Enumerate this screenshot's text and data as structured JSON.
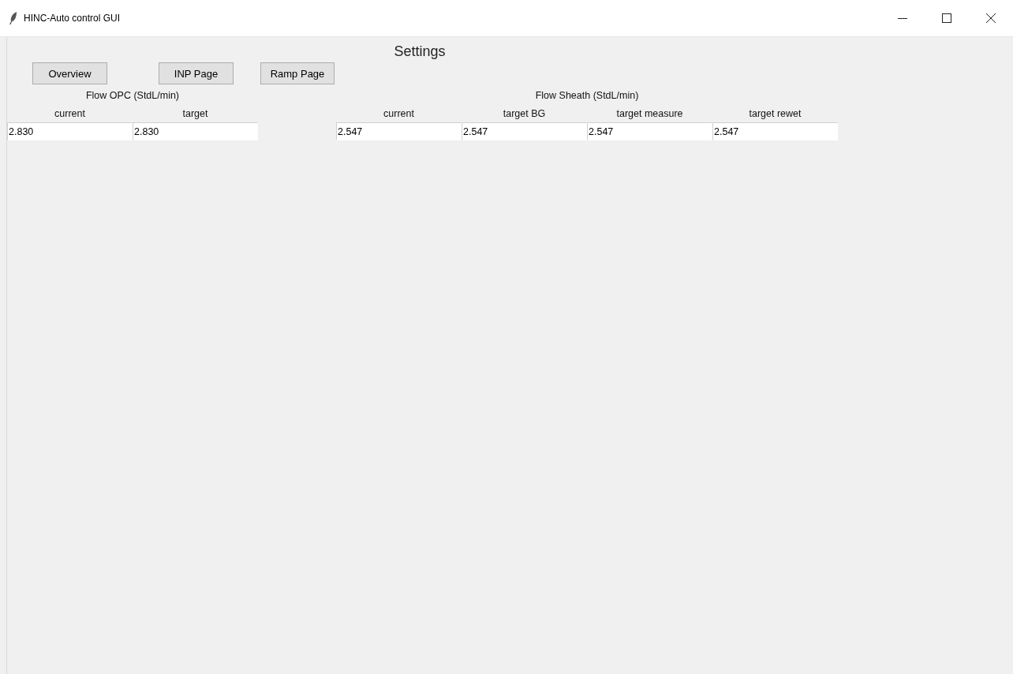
{
  "window": {
    "title": "HINC-Auto control GUI"
  },
  "heading": "Settings",
  "buttons": [
    "Overview",
    "INP Page",
    "Ramp Page"
  ],
  "groups": [
    {
      "title": "Flow OPC (StdL/min)",
      "fields": [
        {
          "label": "current",
          "value": "2.830"
        },
        {
          "label": "target",
          "value": "2.830"
        }
      ]
    },
    {
      "title": "Flow Sheath (StdL/min)",
      "fields": [
        {
          "label": "current",
          "value": "2.547"
        },
        {
          "label": "target BG",
          "value": "2.547"
        },
        {
          "label": "target measure",
          "value": "2.547"
        },
        {
          "label": "target rewet",
          "value": "2.547"
        }
      ]
    }
  ]
}
